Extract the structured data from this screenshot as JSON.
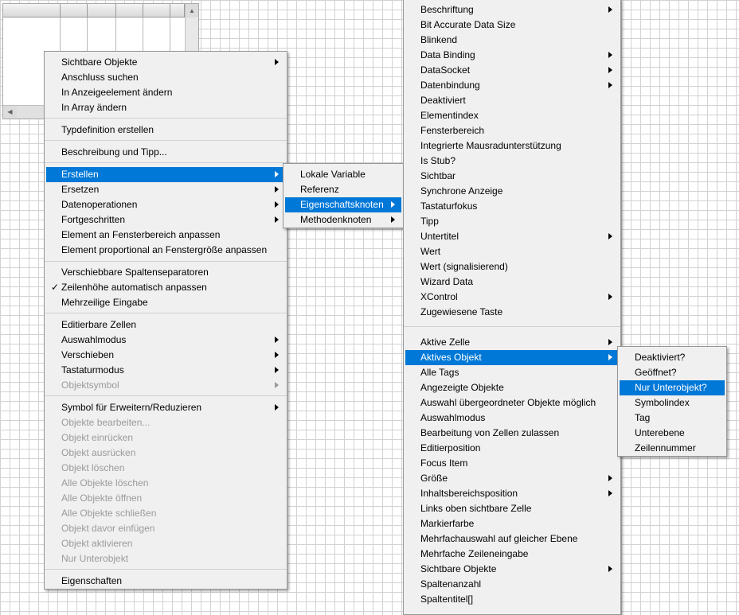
{
  "menu_main": {
    "items": [
      {
        "label": "Sichtbare Objekte",
        "arrow": true
      },
      {
        "label": "Anschluss suchen"
      },
      {
        "label": "In Anzeigeelement ändern"
      },
      {
        "label": "In Array ändern"
      },
      {
        "label": "Typdefinition erstellen"
      },
      {
        "label": "Beschreibung und Tipp..."
      },
      {
        "label": "Erstellen",
        "arrow": true,
        "highlighted": true
      },
      {
        "label": "Ersetzen",
        "arrow": true
      },
      {
        "label": "Datenoperationen",
        "arrow": true
      },
      {
        "label": "Fortgeschritten",
        "arrow": true
      },
      {
        "label": "Element an Fensterbereich anpassen"
      },
      {
        "label": "Element proportional an Fenstergröße anpassen"
      },
      {
        "label": "Verschiebbare Spaltenseparatoren"
      },
      {
        "label": "Zeilenhöhe automatisch anpassen",
        "checked": true
      },
      {
        "label": "Mehrzeilige Eingabe"
      },
      {
        "label": "Editierbare Zellen"
      },
      {
        "label": "Auswahlmodus",
        "arrow": true
      },
      {
        "label": "Verschieben",
        "arrow": true
      },
      {
        "label": "Tastaturmodus",
        "arrow": true
      },
      {
        "label": "Objektsymbol",
        "arrow": true,
        "disabled": true
      },
      {
        "label": "Symbol für Erweitern/Reduzieren",
        "arrow": true
      },
      {
        "label": "Objekte bearbeiten...",
        "disabled": true
      },
      {
        "label": "Objekt einrücken",
        "disabled": true
      },
      {
        "label": "Objekt ausrücken",
        "disabled": true
      },
      {
        "label": "Objekt löschen",
        "disabled": true
      },
      {
        "label": "Alle Objekte löschen",
        "disabled": true
      },
      {
        "label": "Alle Objekte öffnen",
        "disabled": true
      },
      {
        "label": "Alle Objekte schließen",
        "disabled": true
      },
      {
        "label": "Objekt davor einfügen",
        "disabled": true
      },
      {
        "label": "Objekt aktivieren",
        "disabled": true
      },
      {
        "label": "Nur Unterobjekt",
        "disabled": true
      },
      {
        "label": "Eigenschaften"
      }
    ]
  },
  "menu_create": {
    "items": [
      {
        "label": "Lokale Variable"
      },
      {
        "label": "Referenz"
      },
      {
        "label": "Eigenschaftsknoten",
        "arrow": true,
        "highlighted": true
      },
      {
        "label": "Methodenknoten",
        "arrow": true
      }
    ]
  },
  "menu_properties": {
    "items": [
      {
        "label": "Beschriftung",
        "arrow": true
      },
      {
        "label": "Bit Accurate Data Size"
      },
      {
        "label": "Blinkend"
      },
      {
        "label": "Data Binding",
        "arrow": true
      },
      {
        "label": "DataSocket",
        "arrow": true
      },
      {
        "label": "Datenbindung",
        "arrow": true
      },
      {
        "label": "Deaktiviert"
      },
      {
        "label": "Elementindex"
      },
      {
        "label": "Fensterbereich"
      },
      {
        "label": "Integrierte Mausradunterstützung"
      },
      {
        "label": "Is Stub?"
      },
      {
        "label": "Sichtbar"
      },
      {
        "label": "Synchrone Anzeige"
      },
      {
        "label": "Tastaturfokus"
      },
      {
        "label": "Tipp"
      },
      {
        "label": "Untertitel",
        "arrow": true
      },
      {
        "label": "Wert"
      },
      {
        "label": "Wert (signalisierend)"
      },
      {
        "label": "Wizard Data"
      },
      {
        "label": "XControl",
        "arrow": true
      },
      {
        "label": "Zugewiesene Taste"
      },
      {
        "label": "Aktive Zelle",
        "arrow": true
      },
      {
        "label": "Aktives Objekt",
        "arrow": true,
        "highlighted": true
      },
      {
        "label": "Alle Tags"
      },
      {
        "label": "Angezeigte Objekte"
      },
      {
        "label": "Auswahl übergeordneter Objekte möglich"
      },
      {
        "label": "Auswahlmodus"
      },
      {
        "label": "Bearbeitung von Zellen zulassen"
      },
      {
        "label": "Editierposition"
      },
      {
        "label": "Focus Item"
      },
      {
        "label": "Größe",
        "arrow": true
      },
      {
        "label": "Inhaltsbereichsposition",
        "arrow": true
      },
      {
        "label": "Links oben sichtbare Zelle"
      },
      {
        "label": "Markierfarbe"
      },
      {
        "label": "Mehrfachauswahl auf gleicher Ebene"
      },
      {
        "label": "Mehrfache Zeileneingabe"
      },
      {
        "label": "Sichtbare Objekte",
        "arrow": true
      },
      {
        "label": "Spaltenanzahl"
      },
      {
        "label": "Spaltentitel[]"
      }
    ]
  },
  "menu_active_item": {
    "items": [
      {
        "label": "Deaktiviert?"
      },
      {
        "label": "Geöffnet?"
      },
      {
        "label": "Nur Unterobjekt?",
        "highlighted": true
      },
      {
        "label": "Symbolindex"
      },
      {
        "label": "Tag"
      },
      {
        "label": "Unterebene"
      },
      {
        "label": "Zeilennummer"
      }
    ]
  },
  "colors": {
    "highlight": "#0078d7",
    "menu_bg": "#f0f0f0",
    "disabled_text": "#9a9a9a"
  }
}
